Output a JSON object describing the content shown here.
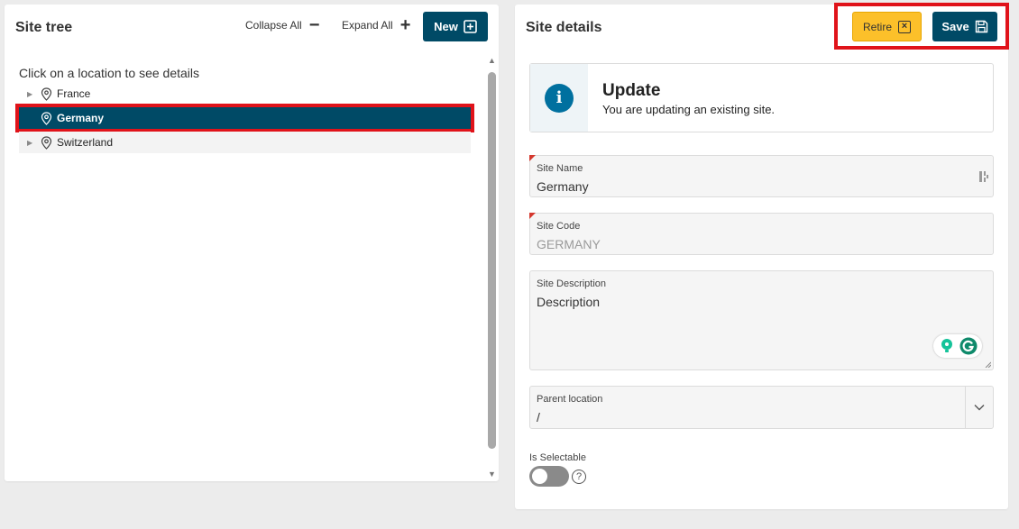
{
  "site_tree": {
    "title": "Site tree",
    "collapse_all": "Collapse All",
    "expand_all": "Expand All",
    "new_label": "New",
    "hint": "Click on a location to see details",
    "items": [
      {
        "label": "France",
        "expandable": true,
        "selected": false
      },
      {
        "label": "Germany",
        "expandable": false,
        "selected": true
      },
      {
        "label": "Switzerland",
        "expandable": true,
        "selected": false
      }
    ]
  },
  "site_details": {
    "title": "Site details",
    "retire_label": "Retire",
    "save_label": "Save",
    "info": {
      "title": "Update",
      "message": "You are updating an existing site.",
      "icon": "info-icon"
    },
    "fields": {
      "site_name": {
        "label": "Site Name",
        "value": "Germany",
        "required": true
      },
      "site_code": {
        "label": "Site Code",
        "value": "GERMANY",
        "required": true,
        "disabled": true
      },
      "site_description": {
        "label": "Site Description",
        "value": "Description"
      },
      "parent_location": {
        "label": "Parent location",
        "value": "/"
      },
      "is_selectable": {
        "label": "Is Selectable",
        "value": false
      }
    }
  },
  "colors": {
    "primary": "#004a66",
    "accent_yellow": "#fcc02a",
    "highlight_red": "#e0131a",
    "info_blue": "#00709f",
    "background": "#ececec"
  }
}
